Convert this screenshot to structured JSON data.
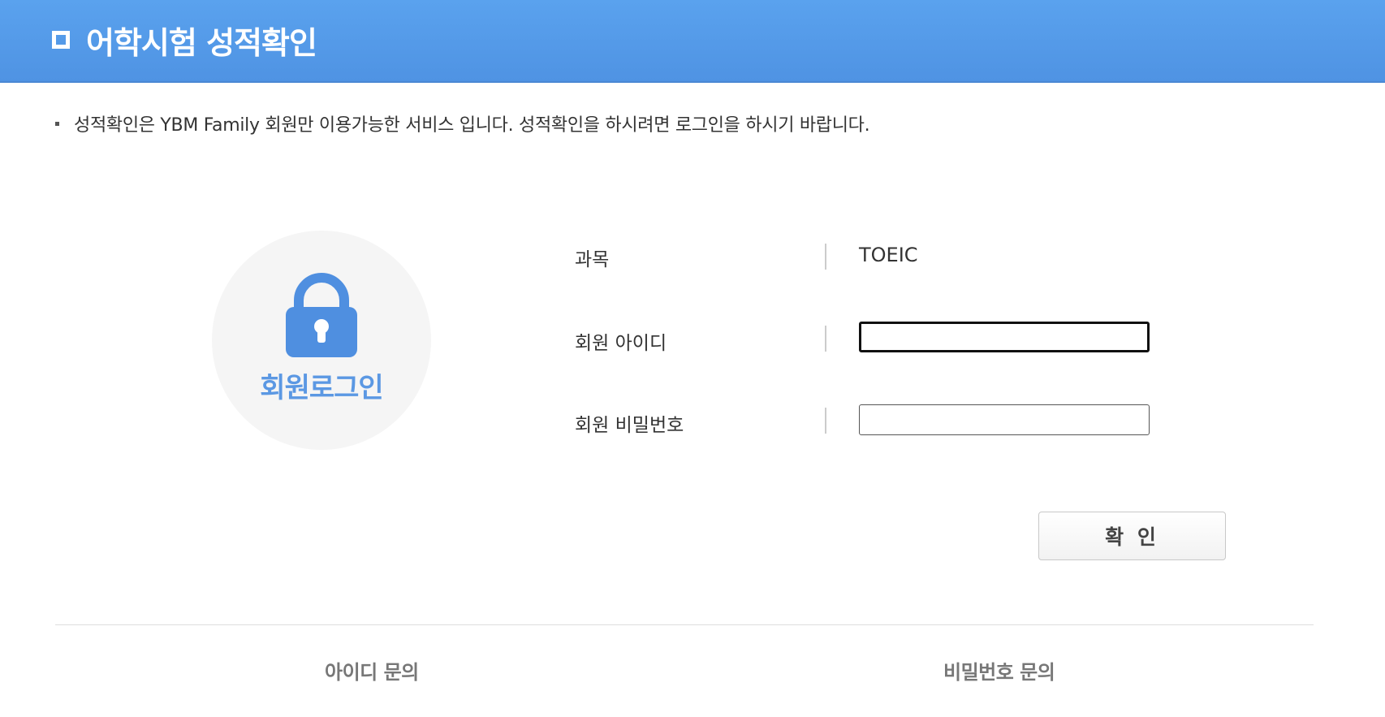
{
  "header": {
    "title": "어학시험 성적확인"
  },
  "notice": {
    "text": "성적확인은 YBM Family 회원만 이용가능한 서비스 입니다. 성적확인을 하시려면 로그인을 하시기 바랍니다."
  },
  "login_badge": {
    "icon": "lock-icon",
    "label": "회원로그인",
    "accent_color": "#4f8fe0"
  },
  "form": {
    "subject_label": "과목",
    "subject_value": "TOEIC",
    "id_label": "회원 아이디",
    "id_value": "",
    "password_label": "회원 비밀번호",
    "password_value": "",
    "submit_label": "확 인"
  },
  "footer": {
    "id_inquiry": "아이디 문의",
    "password_inquiry": "비밀번호 문의"
  }
}
